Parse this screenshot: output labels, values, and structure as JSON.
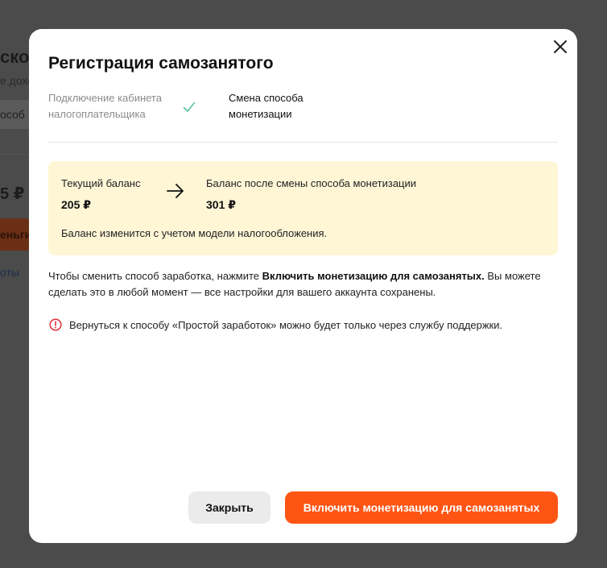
{
  "background": {
    "title": "скоо",
    "subtitle": "е дохо",
    "chip": "особ",
    "balance": "5 ₽",
    "button": "еньги",
    "link": "оты"
  },
  "modal": {
    "title": "Регистрация самозанятого",
    "close_icon": "close-icon",
    "steps": [
      {
        "label": "Подключение кабинета налогоплательщика",
        "status": "done"
      },
      {
        "label": "Смена способа монетизации",
        "status": "current"
      }
    ],
    "balance": {
      "current_label": "Текущий баланс",
      "current_value": "205 ₽",
      "after_label": "Баланс после смены способа монетизации",
      "after_value": "301 ₽",
      "note": "Баланс изменится с учетом модели налогообложения."
    },
    "info": {
      "prefix": "Чтобы сменить способ заработка, нажмите ",
      "bold": "Включить монетизацию для самозанятых.",
      "suffix": " Вы можете сделать это в любой момент — все настройки для вашего аккаунта сохранены."
    },
    "warning": "Вернуться к способу «Простой заработок» можно будет только через службу поддержки.",
    "buttons": {
      "close": "Закрыть",
      "primary": "Включить монетизацию для самозанятых"
    }
  },
  "colors": {
    "overlay": "#4b4b4b",
    "accent": "#ff5514",
    "balance_bg": "#fff6d6",
    "check": "#5cc39a",
    "warning": "#e0323b"
  }
}
